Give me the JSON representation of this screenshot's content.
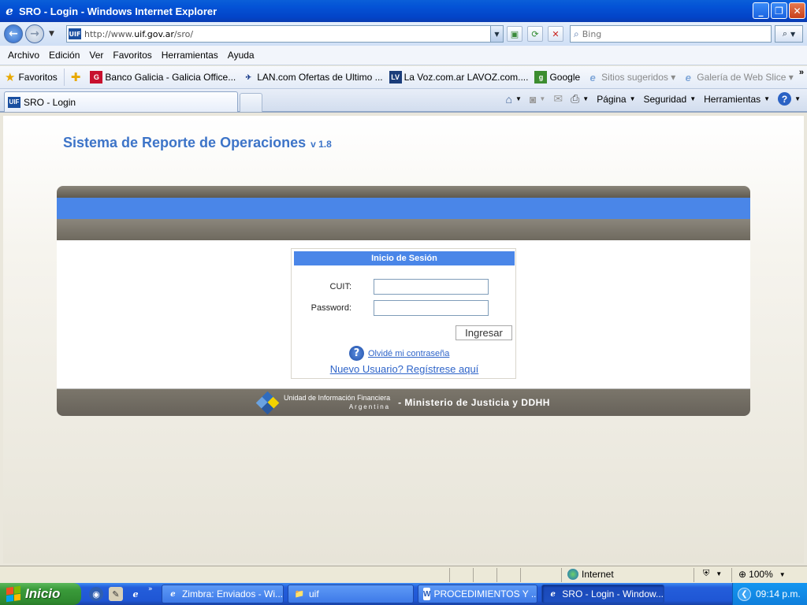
{
  "window": {
    "title": "SRO - Login - Windows Internet Explorer",
    "app_icon": "e",
    "controls": {
      "minimize": "_",
      "maximize": "❐",
      "close": "✕"
    }
  },
  "address": {
    "site_icon": "UIF",
    "url_prefix": "http://www.",
    "url_host": "uif.gov.ar",
    "url_path": "/sro/",
    "search_placeholder": "Bing"
  },
  "menu": [
    "Archivo",
    "Edición",
    "Ver",
    "Favoritos",
    "Herramientas",
    "Ayuda"
  ],
  "favorites": {
    "label": "Favoritos",
    "items": [
      {
        "label": "Banco Galicia - Galicia Office...",
        "icon": "G",
        "color": "#c8102e"
      },
      {
        "label": "LAN.com Ofertas de Ultimo ...",
        "icon": "✈",
        "color": "#1a3c8a"
      },
      {
        "label": "La Voz.com.ar  LAVOZ.com....",
        "icon": "LV",
        "color": "#1b3d7a"
      },
      {
        "label": "Google",
        "icon": "g",
        "color": "#3c8d2f"
      },
      {
        "label": "Sitios sugeridos ▾",
        "icon": "e",
        "color": "#7fa6d8"
      },
      {
        "label": "Galería de Web Slice ▾",
        "icon": "e",
        "color": "#7fa6d8"
      }
    ],
    "more": "»"
  },
  "tab": {
    "label": "SRO - Login"
  },
  "commands": {
    "page": "Página",
    "security": "Seguridad",
    "tools": "Herramientas"
  },
  "page": {
    "title": "Sistema de Reporte de Operaciones",
    "version": "v 1.8",
    "login": {
      "header": "Inicio de Sesión",
      "cuit_label": "CUIT:",
      "password_label": "Password:",
      "cuit_value": "",
      "password_value": "",
      "submit": "Ingresar",
      "forgot": "Olvidé mi contraseña",
      "new_user": "Nuevo Usuario? Regístrese aquí"
    },
    "footer": {
      "org_name": "Unidad de Información Financiera",
      "org_country": "Argentina",
      "ministry": "- Ministerio de Justicia y DDHH"
    }
  },
  "status": {
    "zone": "Internet",
    "zoom": "100%"
  },
  "taskbar": {
    "start": "Inicio",
    "tasks": [
      {
        "label": "Zimbra: Enviados - Wi...",
        "icon": "e"
      },
      {
        "label": "uif",
        "icon": "📁"
      },
      {
        "label": "PROCEDIMIENTOS Y ...",
        "icon": "W"
      },
      {
        "label": "SRO - Login - Window...",
        "icon": "e"
      }
    ],
    "clock": "09:14 p.m."
  },
  "colors": {
    "accent_blue": "#4a86e8",
    "title_blue": "#3d74c8",
    "band_gray": "#6e695e"
  }
}
